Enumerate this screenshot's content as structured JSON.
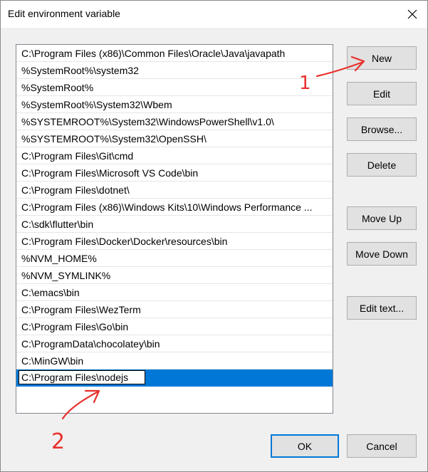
{
  "window": {
    "title": "Edit environment variable"
  },
  "paths": [
    "C:\\Program Files (x86)\\Common Files\\Oracle\\Java\\javapath",
    "%SystemRoot%\\system32",
    "%SystemRoot%",
    "%SystemRoot%\\System32\\Wbem",
    "%SYSTEMROOT%\\System32\\WindowsPowerShell\\v1.0\\",
    "%SYSTEMROOT%\\System32\\OpenSSH\\",
    "C:\\Program Files\\Git\\cmd",
    "C:\\Program Files\\Microsoft VS Code\\bin",
    "C:\\Program Files\\dotnet\\",
    "C:\\Program Files (x86)\\Windows Kits\\10\\Windows Performance ...",
    "C:\\sdk\\flutter\\bin",
    "C:\\Program Files\\Docker\\Docker\\resources\\bin",
    "%NVM_HOME%",
    "%NVM_SYMLINK%",
    "C:\\emacs\\bin",
    "C:\\Program Files\\WezTerm",
    "C:\\Program Files\\Go\\bin",
    "C:\\ProgramData\\chocolatey\\bin",
    "C:\\MinGW\\bin"
  ],
  "editing_value": "C:\\Program Files\\nodejs",
  "buttons": {
    "new": "New",
    "edit": "Edit",
    "browse": "Browse...",
    "delete": "Delete",
    "move_up": "Move Up",
    "move_down": "Move Down",
    "edit_text": "Edit text...",
    "ok": "OK",
    "cancel": "Cancel"
  },
  "annotations": {
    "step1": "1",
    "step2": "2",
    "color": "#e8302c"
  },
  "colors": {
    "selection": "#0078d7",
    "button_face": "#e1e1e1",
    "dialog_bg": "#f0f0f0"
  }
}
